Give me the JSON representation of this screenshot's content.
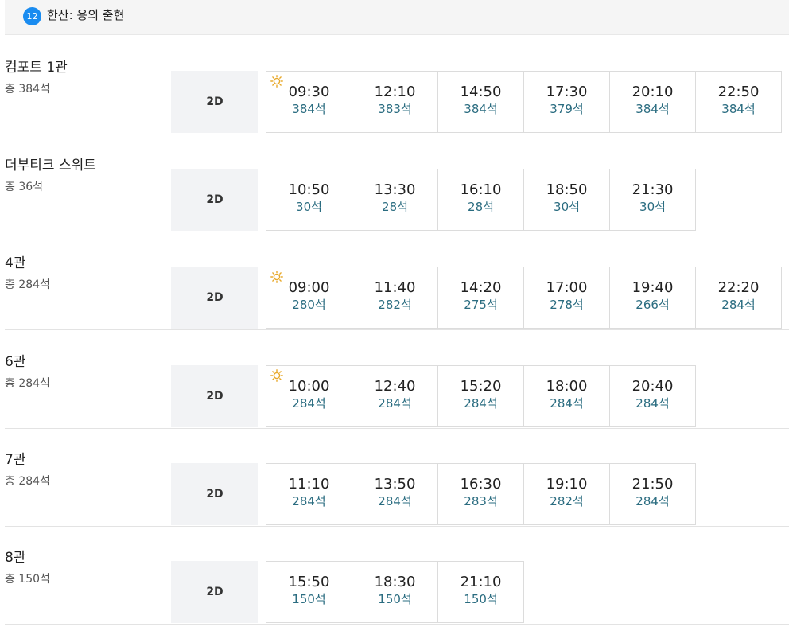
{
  "movie": {
    "rating": "12",
    "title": "한산: 용의 출현"
  },
  "halls": [
    {
      "name": "컴포트 1관",
      "total": "총 384석",
      "format": "2D",
      "times": [
        {
          "time": "09:30",
          "seats": "384석",
          "morning": true
        },
        {
          "time": "12:10",
          "seats": "383석",
          "morning": false
        },
        {
          "time": "14:50",
          "seats": "384석",
          "morning": false
        },
        {
          "time": "17:30",
          "seats": "379석",
          "morning": false
        },
        {
          "time": "20:10",
          "seats": "384석",
          "morning": false
        },
        {
          "time": "22:50",
          "seats": "384석",
          "morning": false
        }
      ]
    },
    {
      "name": "더부티크 스위트",
      "total": "총 36석",
      "format": "2D",
      "times": [
        {
          "time": "10:50",
          "seats": "30석",
          "morning": false
        },
        {
          "time": "13:30",
          "seats": "28석",
          "morning": false
        },
        {
          "time": "16:10",
          "seats": "28석",
          "morning": false
        },
        {
          "time": "18:50",
          "seats": "30석",
          "morning": false
        },
        {
          "time": "21:30",
          "seats": "30석",
          "morning": false
        }
      ]
    },
    {
      "name": "4관",
      "total": "총 284석",
      "format": "2D",
      "times": [
        {
          "time": "09:00",
          "seats": "280석",
          "morning": true
        },
        {
          "time": "11:40",
          "seats": "282석",
          "morning": false
        },
        {
          "time": "14:20",
          "seats": "275석",
          "morning": false
        },
        {
          "time": "17:00",
          "seats": "278석",
          "morning": false
        },
        {
          "time": "19:40",
          "seats": "266석",
          "morning": false
        },
        {
          "time": "22:20",
          "seats": "284석",
          "morning": false
        }
      ]
    },
    {
      "name": "6관",
      "total": "총 284석",
      "format": "2D",
      "times": [
        {
          "time": "10:00",
          "seats": "284석",
          "morning": true
        },
        {
          "time": "12:40",
          "seats": "284석",
          "morning": false
        },
        {
          "time": "15:20",
          "seats": "284석",
          "morning": false
        },
        {
          "time": "18:00",
          "seats": "284석",
          "morning": false
        },
        {
          "time": "20:40",
          "seats": "284석",
          "morning": false
        }
      ]
    },
    {
      "name": "7관",
      "total": "총 284석",
      "format": "2D",
      "times": [
        {
          "time": "11:10",
          "seats": "284석",
          "morning": false
        },
        {
          "time": "13:50",
          "seats": "284석",
          "morning": false
        },
        {
          "time": "16:30",
          "seats": "283석",
          "morning": false
        },
        {
          "time": "19:10",
          "seats": "282석",
          "morning": false
        },
        {
          "time": "21:50",
          "seats": "284석",
          "morning": false
        }
      ]
    },
    {
      "name": "8관",
      "total": "총 150석",
      "format": "2D",
      "times": [
        {
          "time": "15:50",
          "seats": "150석",
          "morning": false
        },
        {
          "time": "18:30",
          "seats": "150석",
          "morning": false
        },
        {
          "time": "21:10",
          "seats": "150석",
          "morning": false
        }
      ]
    }
  ],
  "colors": {
    "badge": "#1a8cf0",
    "seats_text": "#2a6c80",
    "sun_icon": "#e8a92b"
  },
  "icons": {
    "rating": "rating-12-badge",
    "morning": "sun-icon"
  }
}
